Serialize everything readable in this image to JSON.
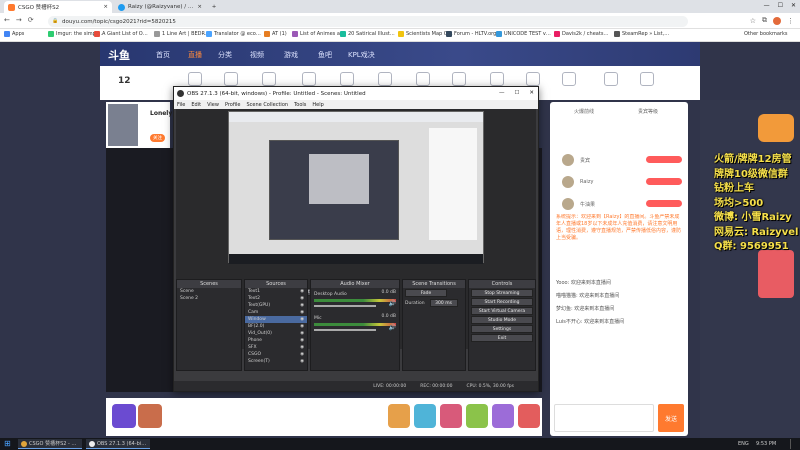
{
  "browser": {
    "tabs": [
      {
        "title": "CSGO 赞槽杯S2",
        "active": true
      },
      {
        "title": "Raizy (@Raizyvane) / Twitter",
        "active": false
      }
    ],
    "new_tab": "+",
    "url": "douyu.com/topic/csgo2021?rid=5820215",
    "bookmarks": [
      "Apps",
      "Imgur: the simple i...",
      "A Giant List of Over...",
      "1 Line Art | BEDRIN...",
      "Translator @ econto...",
      "AT (1)",
      "List of Animes and...",
      "20 Satirical Illustrati...",
      "Scientists Map Out...",
      "Forum - HLTV.org",
      "UNICODE TEST v4...",
      "Davis2k / cheatsec...",
      "SteamRep » List, Bo..."
    ],
    "other_bookmarks": "Other bookmarks"
  },
  "site": {
    "logo": "斗鱼",
    "nav": [
      "首页",
      "直播",
      "分类",
      "视频",
      "游戏",
      "鱼吧",
      "KPL戏决"
    ],
    "nav_active": 1,
    "streamer_level": "12",
    "streamer_label": "Lonely",
    "follow_btn": "关注"
  },
  "obs": {
    "title": "OBS 27.1.3 (64-bit, windows) - Profile: Untitled - Scenes: Untitled",
    "menu": [
      "File",
      "Edit",
      "View",
      "Profile",
      "Scene Collection",
      "Tools",
      "Help"
    ],
    "no_source": "No source selected",
    "properties": "Properties",
    "filters": "Filters",
    "panels": {
      "scenes": "Scenes",
      "sources": "Sources",
      "mixer": "Audio Mixer",
      "transitions": "Scene Transitions",
      "controls": "Controls"
    },
    "scenes": [
      "Scene",
      "Scene 2"
    ],
    "sources": [
      "Text1",
      "Text2",
      "Text(GPU)",
      "Cam",
      "Window",
      "BF(2.0)",
      "Vid_Out(0)",
      "Phone",
      "SFX",
      "CSGO",
      "Screen(T)",
      "Display"
    ],
    "mixer": [
      {
        "name": "Desktop Audio",
        "db": "0.0 dB"
      },
      {
        "name": "Mic",
        "db": "0.0 dB"
      }
    ],
    "transition": "Fade",
    "duration_label": "Duration",
    "duration_value": "300 ms",
    "controls": [
      "Stop Streaming",
      "Start Recording",
      "Start Virtual Camera",
      "Studio Mode",
      "Settings",
      "Exit"
    ],
    "status": {
      "live": "LIVE: 00:00:00",
      "rec": "REC: 00:00:00",
      "cpu": "CPU: 0.5%, 30.00 fps"
    }
  },
  "chat": {
    "tabs": [
      "火爆前线",
      "贵宾等级"
    ],
    "users": [
      "贵宾",
      "Raizy",
      "牛油果"
    ],
    "notice": "系统提示：欢迎来到【Raizy】的直播间。斗鱼严禁未成年人直播或18岁以下未成年人充值消费，请注意文明用语，理性消费，遵守直播规范，严禁传播低俗内容，谨防上当受骗。",
    "messages": [
      "Yooo: 欢迎来到本直播间",
      "喵喵猫猫: 欢迎来到本直播间",
      "梦幻鱼: 欢迎来到本直播间",
      "Luis不开心: 欢迎来到本直播间"
    ],
    "send": "发送"
  },
  "overlay": [
    "火箭/牌牌12房管",
    "牌牌10级微信群",
    "钻粉上车",
    "场均>500",
    "微博: 小雪Raizy",
    "网易云: Raizyvel",
    "Q群: 9569951"
  ],
  "taskbar": {
    "items": [
      "CSGO 赞槽杯S2 - Go...",
      "OBS 27.1.3 (64-bit, wi..."
    ],
    "lang": "ENG",
    "time": "9:53 PM"
  },
  "colors": {
    "accent": "#ff7a2f",
    "nav_bg": "#283770",
    "obs_dark": "#2b2b2e",
    "overlay_text": "#f6e04a"
  }
}
